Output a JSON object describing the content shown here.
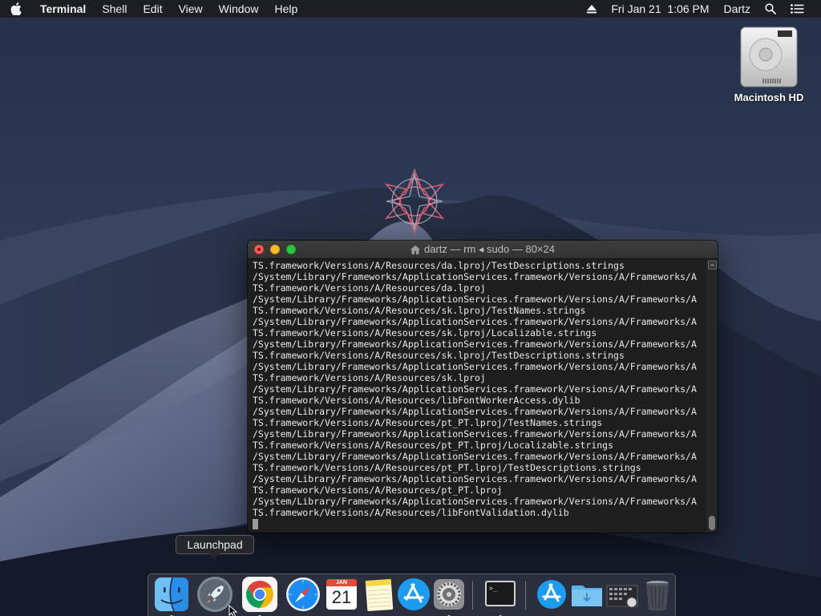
{
  "menubar": {
    "app_name": "Terminal",
    "items": [
      "Shell",
      "Edit",
      "View",
      "Window",
      "Help"
    ],
    "datetime": "Fri Jan 21  1:06 PM",
    "user": "Dartz",
    "icons": [
      "apple-icon",
      "eject-icon",
      "spotlight-search-icon",
      "notification-center-icon"
    ]
  },
  "desktop": {
    "drive_label": "Macintosh HD"
  },
  "terminal": {
    "title": "dartz — rm ◂ sudo — 80×24",
    "lines": [
      "TS.framework/Versions/A/Resources/da.lproj/TestDescriptions.strings",
      "/System/Library/Frameworks/ApplicationServices.framework/Versions/A/Frameworks/A",
      "TS.framework/Versions/A/Resources/da.lproj",
      "/System/Library/Frameworks/ApplicationServices.framework/Versions/A/Frameworks/A",
      "TS.framework/Versions/A/Resources/sk.lproj/TestNames.strings",
      "/System/Library/Frameworks/ApplicationServices.framework/Versions/A/Frameworks/A",
      "TS.framework/Versions/A/Resources/sk.lproj/Localizable.strings",
      "/System/Library/Frameworks/ApplicationServices.framework/Versions/A/Frameworks/A",
      "TS.framework/Versions/A/Resources/sk.lproj/TestDescriptions.strings",
      "/System/Library/Frameworks/ApplicationServices.framework/Versions/A/Frameworks/A",
      "TS.framework/Versions/A/Resources/sk.lproj",
      "/System/Library/Frameworks/ApplicationServices.framework/Versions/A/Frameworks/A",
      "TS.framework/Versions/A/Resources/libFontWorkerAccess.dylib",
      "/System/Library/Frameworks/ApplicationServices.framework/Versions/A/Frameworks/A",
      "TS.framework/Versions/A/Resources/pt_PT.lproj/TestNames.strings",
      "/System/Library/Frameworks/ApplicationServices.framework/Versions/A/Frameworks/A",
      "TS.framework/Versions/A/Resources/pt_PT.lproj/Localizable.strings",
      "/System/Library/Frameworks/ApplicationServices.framework/Versions/A/Frameworks/A",
      "TS.framework/Versions/A/Resources/pt_PT.lproj/TestDescriptions.strings",
      "/System/Library/Frameworks/ApplicationServices.framework/Versions/A/Frameworks/A",
      "TS.framework/Versions/A/Resources/pt_PT.lproj",
      "/System/Library/Frameworks/ApplicationServices.framework/Versions/A/Frameworks/A",
      "TS.framework/Versions/A/Resources/libFontValidation.dylib"
    ]
  },
  "tooltip": {
    "text": "Launchpad"
  },
  "dock": {
    "calendar_month": "JAN",
    "calendar_day": "21",
    "items": [
      {
        "icon": "finder-icon",
        "running": true
      },
      {
        "icon": "launchpad-icon",
        "running": false
      },
      {
        "icon": "chrome-icon",
        "running": true
      },
      {
        "icon": "safari-icon",
        "running": false
      },
      {
        "icon": "calendar-icon",
        "running": false
      },
      {
        "icon": "notes-icon",
        "running": false
      },
      {
        "icon": "app-store-icon",
        "running": false
      },
      {
        "icon": "system-preferences-icon",
        "running": true
      },
      {
        "icon": "terminal-icon",
        "running": true
      },
      {
        "icon": "applications-folder-icon",
        "running": false
      },
      {
        "icon": "downloads-folder-icon",
        "running": false
      },
      {
        "icon": "screenshots-stack-icon",
        "running": false
      },
      {
        "icon": "trash-icon",
        "running": false
      }
    ]
  },
  "colors": {
    "terminal_bg": "#1e1e1e",
    "terminal_text": "#e8e8e8",
    "close": "#fc5f57",
    "minimize": "#fdbb2d",
    "maximize": "#27c840"
  }
}
